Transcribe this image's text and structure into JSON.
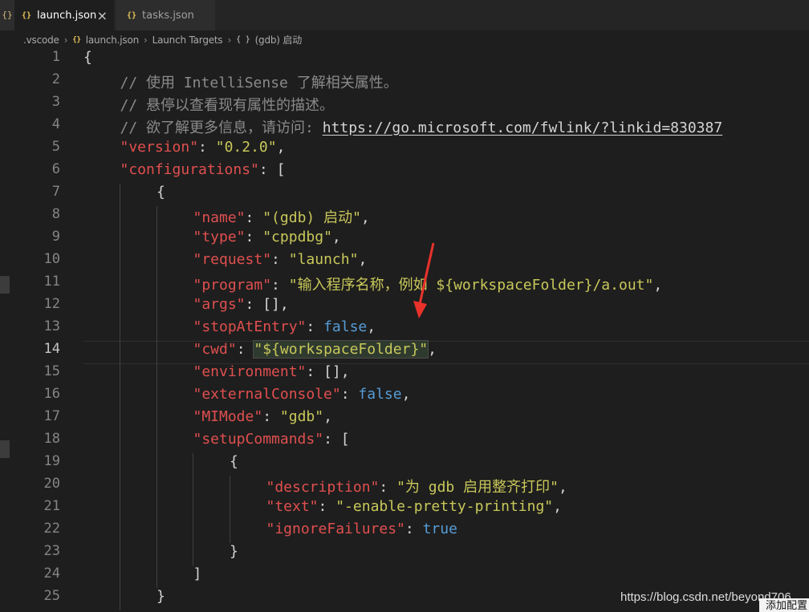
{
  "tabs": [
    {
      "label": "launch.json",
      "icon": "json-braces-icon",
      "active": true
    },
    {
      "label": "tasks.json",
      "icon": "json-braces-icon",
      "active": false
    }
  ],
  "edge_icon_glyph": "{}",
  "json_icon_glyph": "{}",
  "close_glyph": "×",
  "breadcrumb": {
    "folder": ".vscode",
    "file": "launch.json",
    "section": "Launch Targets",
    "object": "(gdb) 启动",
    "object_icon_glyph": "{ }"
  },
  "editor": {
    "current_line": 14,
    "lines": [
      {
        "n": "1",
        "code": "{"
      },
      {
        "n": "2",
        "comment": "// 使用 IntelliSense 了解相关属性。"
      },
      {
        "n": "3",
        "comment": "// 悬停以查看现有属性的描述。"
      },
      {
        "n": "4",
        "comment": "// 欲了解更多信息，请访问: ",
        "link": "https://go.microsoft.com/fwlink/?linkid=830387"
      },
      {
        "n": "5",
        "key": "\"version\"",
        "value": "\"0.2.0\"",
        "tail": ","
      },
      {
        "n": "6",
        "key": "\"configurations\"",
        "tail": ": ["
      },
      {
        "n": "7",
        "code": "{"
      },
      {
        "n": "8",
        "key": "\"name\"",
        "value": "\"(gdb) 启动\"",
        "tail": ","
      },
      {
        "n": "9",
        "key": "\"type\"",
        "value": "\"cppdbg\"",
        "tail": ","
      },
      {
        "n": "10",
        "key": "\"request\"",
        "value": "\"launch\"",
        "tail": ","
      },
      {
        "n": "11",
        "key": "\"program\"",
        "value": "\"输入程序名称，例如 ${workspaceFolder}/a.out\"",
        "tail": ","
      },
      {
        "n": "12",
        "key": "\"args\"",
        "tail": ": [],"
      },
      {
        "n": "13",
        "key": "\"stopAtEntry\"",
        "bool": "false",
        "tail": ","
      },
      {
        "n": "14",
        "key": "\"cwd\"",
        "value": "\"${workspaceFolder}\"",
        "tail": ","
      },
      {
        "n": "15",
        "key": "\"environment\"",
        "tail": ": [],"
      },
      {
        "n": "16",
        "key": "\"externalConsole\"",
        "bool": "false",
        "tail": ","
      },
      {
        "n": "17",
        "key": "\"MIMode\"",
        "value": "\"gdb\"",
        "tail": ","
      },
      {
        "n": "18",
        "key": "\"setupCommands\"",
        "tail": ": ["
      },
      {
        "n": "19",
        "code": "{"
      },
      {
        "n": "20",
        "key": "\"description\"",
        "value": "\"为 gdb 启用整齐打印\"",
        "tail": ","
      },
      {
        "n": "21",
        "key": "\"text\"",
        "value": "\"-enable-pretty-printing\"",
        "tail": ","
      },
      {
        "n": "22",
        "key": "\"ignoreFailures\"",
        "bool": "true",
        "tail": ""
      },
      {
        "n": "23",
        "code": "}"
      },
      {
        "n": "24",
        "code": "]"
      },
      {
        "n": "25",
        "code": "}"
      }
    ]
  },
  "watermark": "https://blog.csdn.net/beyond706",
  "corner_button": "添加配置",
  "colors": {
    "background": "#1e1e1e",
    "key": "#e04f4f",
    "string": "#c8c85a",
    "comment": "#8a8a8a",
    "boolean": "#569cd6",
    "arrow": "#e8322a"
  }
}
